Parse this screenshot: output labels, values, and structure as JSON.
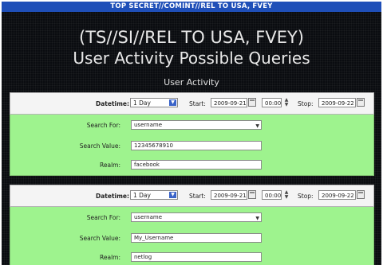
{
  "banner": "TOP SECRET//COMINT//REL TO USA, FVEY",
  "title_line1": "(TS//SI//REL TO USA, FVEY)",
  "title_line2": "User Activity Possible Queries",
  "section_title": "User Activity",
  "panels": [
    {
      "datetime_label": "Datetime:",
      "range": "1 Day",
      "start_label": "Start:",
      "start_date": "2009-09-21",
      "start_time": "00:00",
      "stop_label": "Stop:",
      "stop_date": "2009-09-22",
      "search_for_label": "Search For:",
      "search_for": "username",
      "search_value_label": "Search Value:",
      "search_value": "12345678910",
      "realm_label": "Realm:",
      "realm": "facebook"
    },
    {
      "datetime_label": "Datetime:",
      "range": "1 Day",
      "start_label": "Start:",
      "start_date": "2009-09-21",
      "start_time": "00:00",
      "stop_label": "Stop:",
      "stop_date": "2009-09-22",
      "search_for_label": "Search For:",
      "search_for": "username",
      "search_value_label": "Search Value:",
      "search_value": "My_Username",
      "realm_label": "Realm:",
      "realm": "netlog"
    }
  ],
  "colors": {
    "banner": "#1f4fb8",
    "background": "#0a0c10",
    "form_green": "#9ef38e"
  }
}
